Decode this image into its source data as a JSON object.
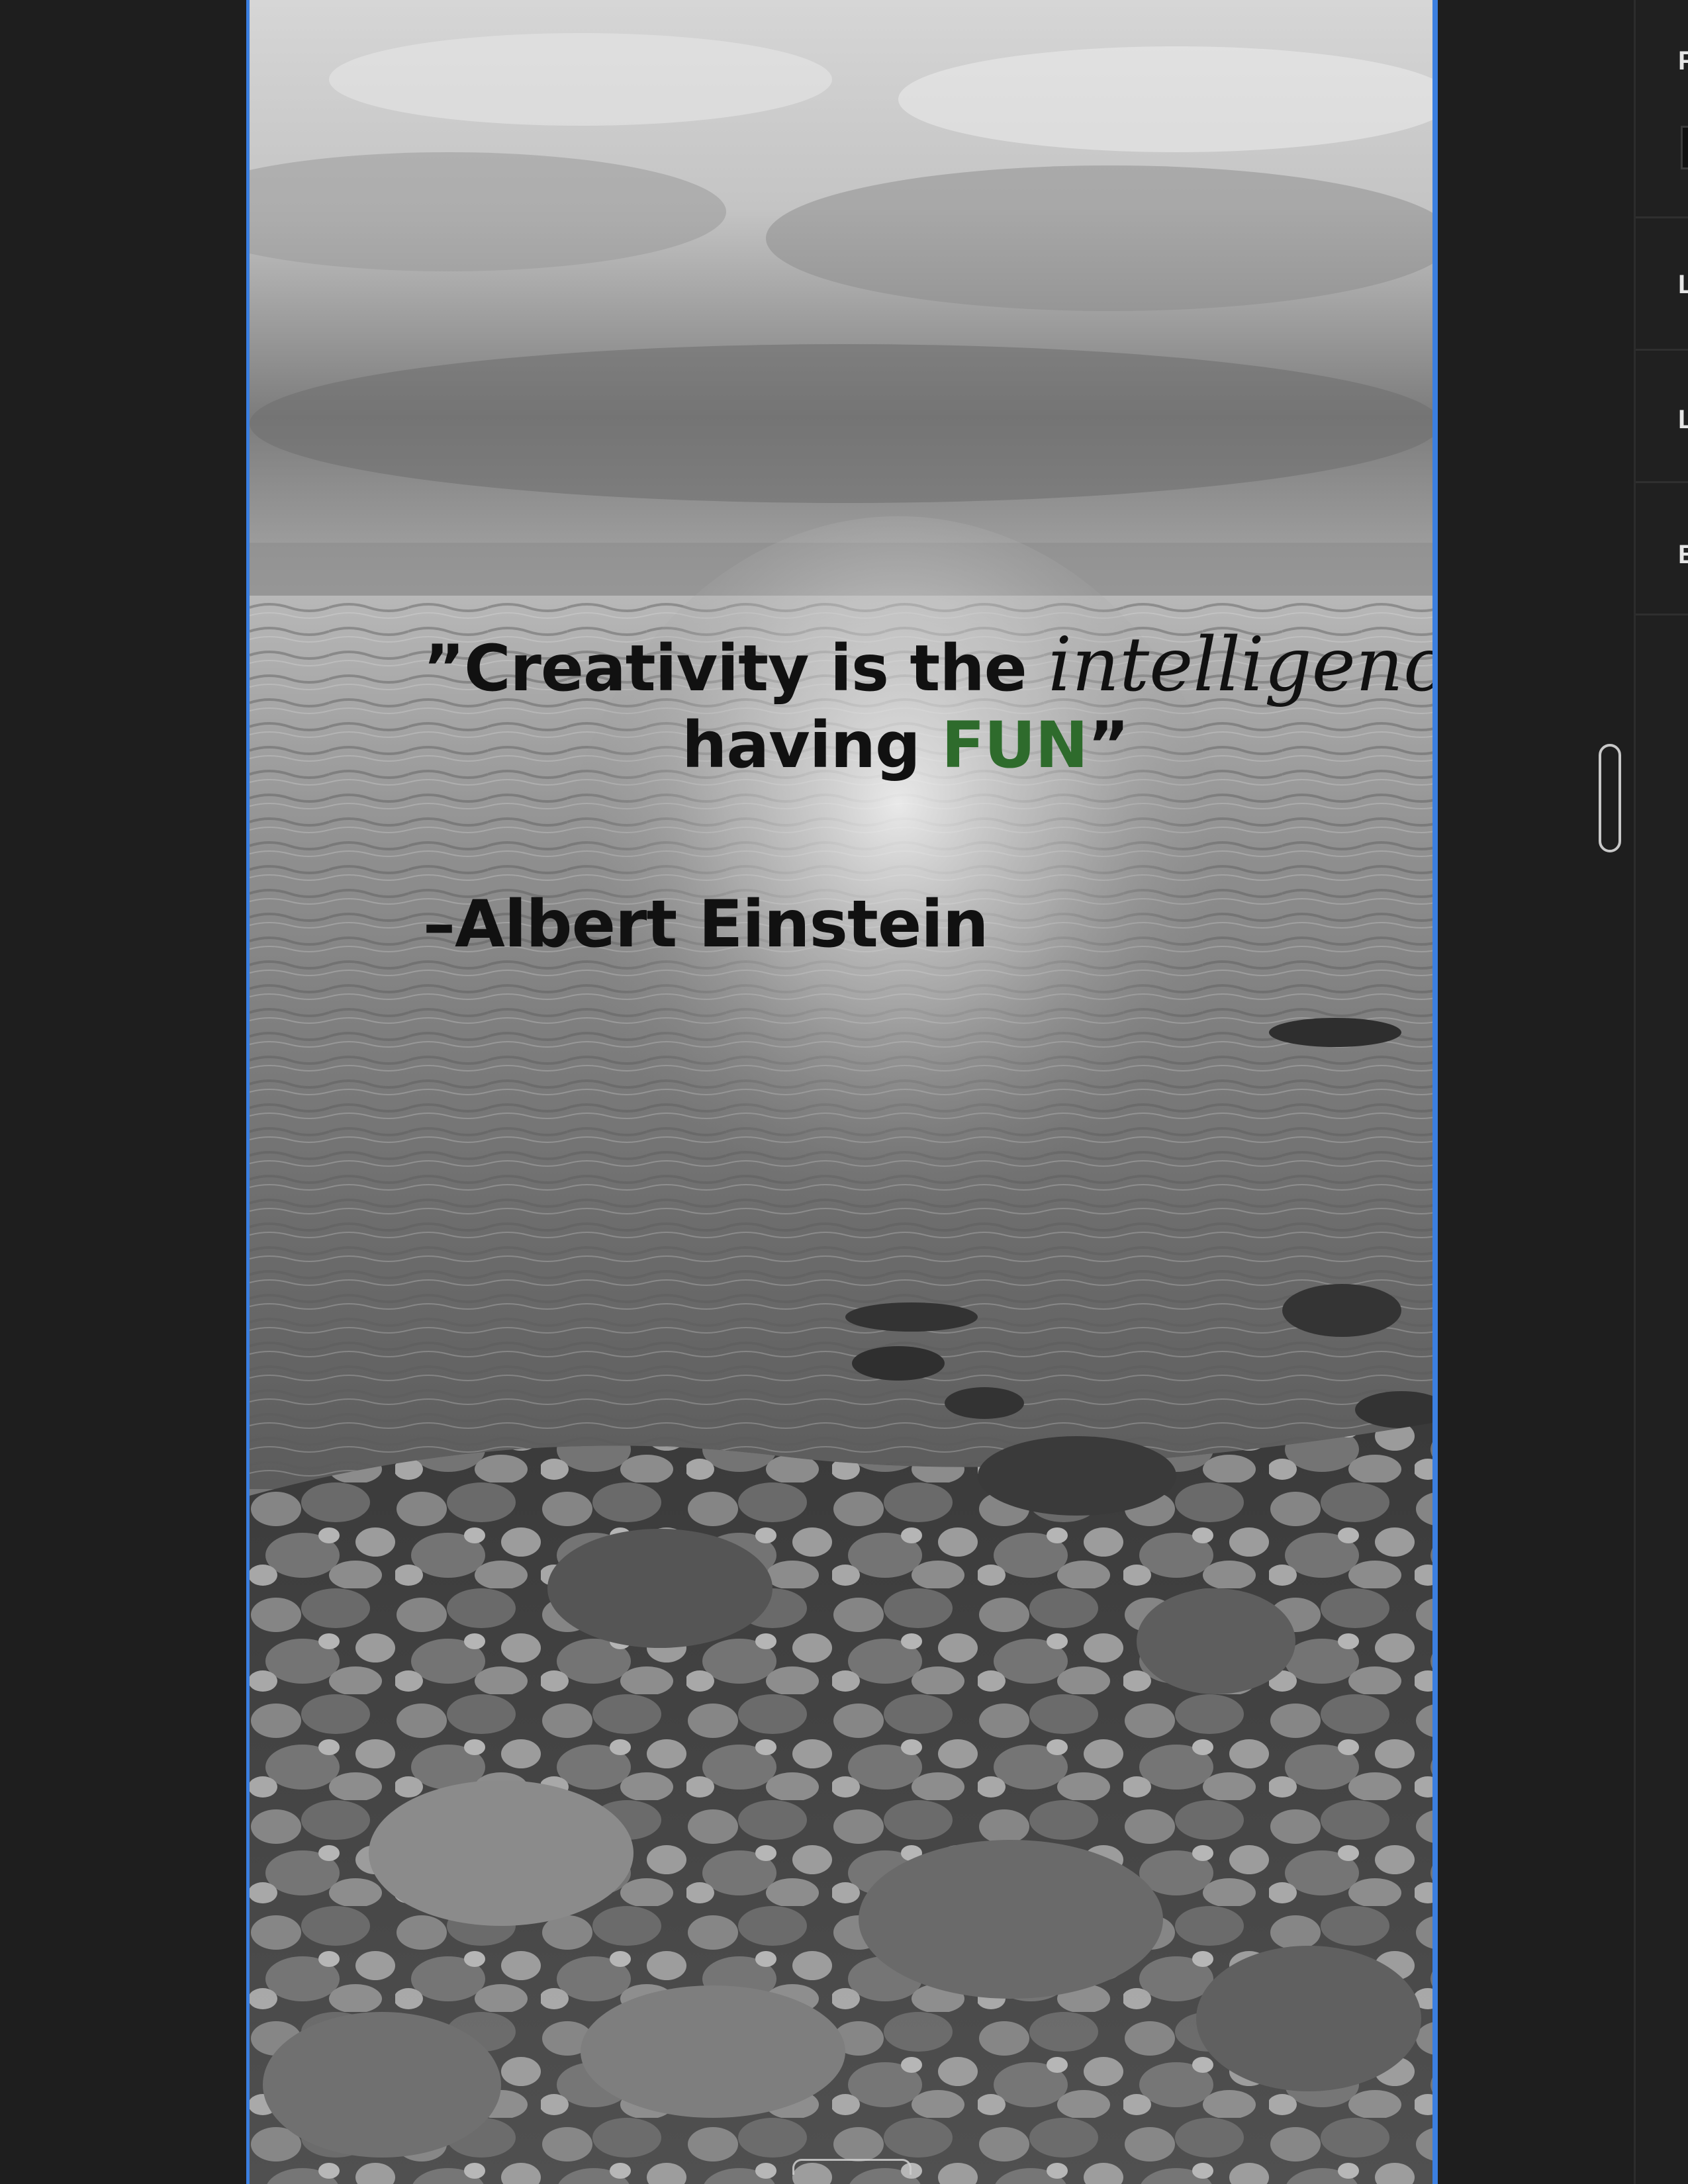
{
  "canvas": {
    "quote": {
      "open_mark": "”",
      "line1_text": "Creativity is the ",
      "emphasis_word": "intelligence",
      "line2_text": "having ",
      "highlight_word": "FUN",
      "close_mark": "”"
    },
    "attribution": "–Albert Einstein",
    "colors": {
      "selection_border": "#3b7fe0",
      "text": "#111111",
      "highlight": "#2e6b2c"
    },
    "background_image": "gray-overcast-sea-and-rocky-shore-photo"
  },
  "side_panel": {
    "sections": [
      {
        "label": "F"
      },
      {
        "label": "L"
      },
      {
        "label": "L"
      },
      {
        "label": "E"
      }
    ]
  }
}
